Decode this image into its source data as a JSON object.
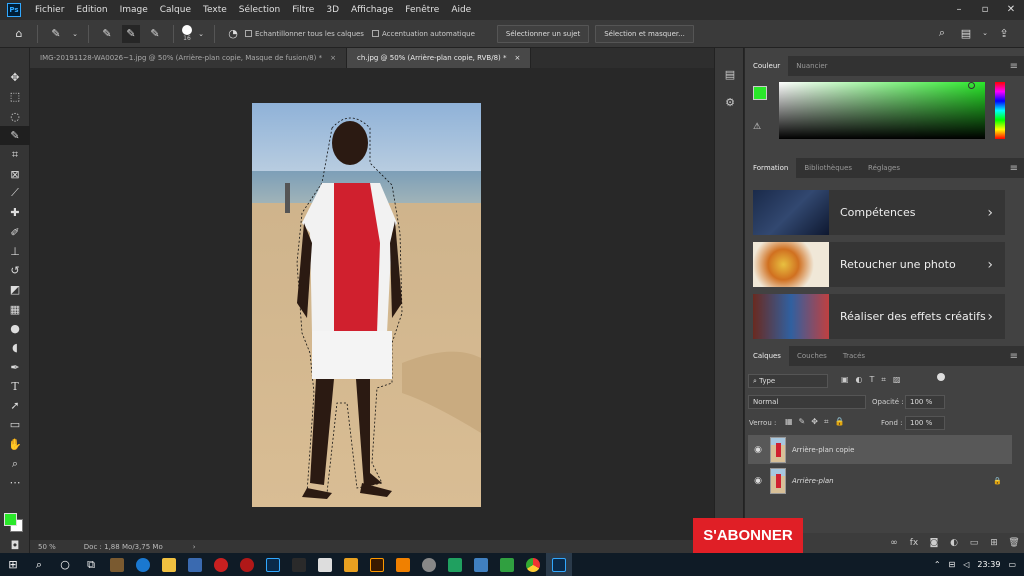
{
  "menubar": {
    "items": [
      "Fichier",
      "Edition",
      "Image",
      "Calque",
      "Texte",
      "Sélection",
      "Filtre",
      "3D",
      "Affichage",
      "Fenêtre",
      "Aide"
    ],
    "logo": "Ps",
    "window_controls": [
      "–",
      "▫",
      "✕"
    ]
  },
  "options": {
    "brush_size": "16",
    "sample_all_label": "Echantillonner tous les calques",
    "auto_enhance_label": "Accentuation automatique",
    "select_subject_btn": "Sélectionner un sujet",
    "select_mask_btn": "Sélection et masquer..."
  },
  "tabs": [
    {
      "label": "IMG-20191128-WA0026~1.jpg @ 50% (Arrière-plan copie, Masque de fusion/8) *",
      "close": "×"
    },
    {
      "label": "ch.jpg @ 50% (Arrière-plan copie, RVB/8) *",
      "close": "×"
    }
  ],
  "status": {
    "zoom": "50 %",
    "doc": "Doc : 1,88 Mo/3,75 Mo",
    "arrow": "›"
  },
  "color_panel": {
    "tabs": [
      "Couleur",
      "Nuancier"
    ],
    "fg_color": "#2ae82a"
  },
  "learn_panel": {
    "tabs": [
      "Formation",
      "Bibliothèques",
      "Réglages"
    ],
    "cards": [
      {
        "label": "Compétences"
      },
      {
        "label": "Retoucher une photo"
      },
      {
        "label": "Réaliser des effets créatifs"
      }
    ]
  },
  "layers_panel": {
    "tabs": [
      "Calques",
      "Couches",
      "Tracés"
    ],
    "filter_type": "Type",
    "blend_mode": "Normal",
    "opacity_label": "Opacité :",
    "opacity_value": "100 %",
    "lock_label": "Verrou :",
    "fill_label": "Fond :",
    "fill_value": "100 %",
    "layers": [
      {
        "name": "Arrière-plan copie"
      },
      {
        "name": "Arrière-plan"
      }
    ]
  },
  "subscribe": {
    "label": "S'ABONNER"
  },
  "taskbar": {
    "time": "23:39"
  }
}
